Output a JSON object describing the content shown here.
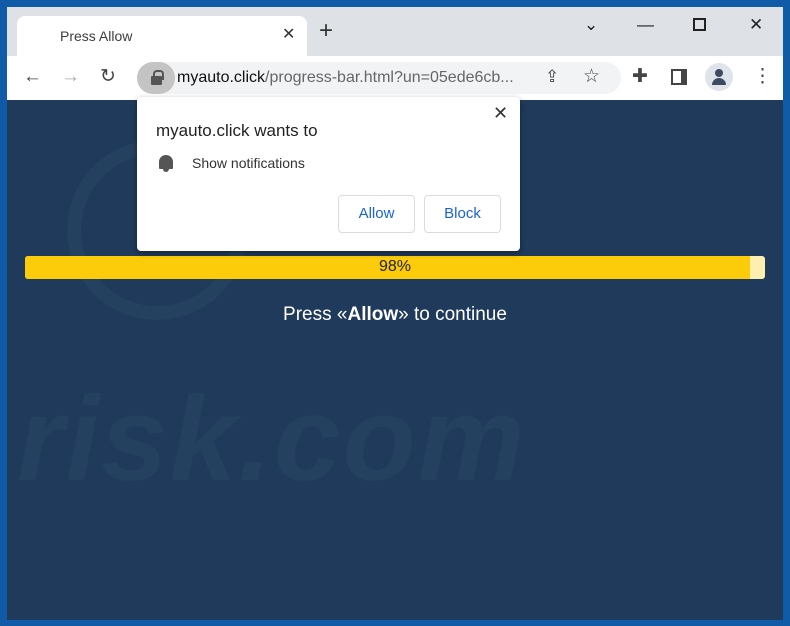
{
  "browser": {
    "tab_title": "Press Allow",
    "url_domain": "myauto.click",
    "url_rest": "/progress-bar.html?un=05ede6cb...",
    "icons": [
      "back-icon",
      "forward-icon",
      "reload-icon",
      "lock-icon",
      "share-icon",
      "star-icon",
      "extensions-icon",
      "sidepanel-icon",
      "profile-icon",
      "menu-icon"
    ]
  },
  "popup": {
    "title": "myauto.click wants to",
    "permission": "Show notifications",
    "allow_label": "Allow",
    "block_label": "Block"
  },
  "page": {
    "progress_percent": 98,
    "progress_label": "98%",
    "msg_pre": "Press «",
    "msg_bold": "Allow",
    "msg_post": "» to continue",
    "watermark": "risk.com"
  },
  "colors": {
    "page_bg": "#1f3a5b",
    "progress": "#fccc0a",
    "button_text": "#1a62d6"
  }
}
